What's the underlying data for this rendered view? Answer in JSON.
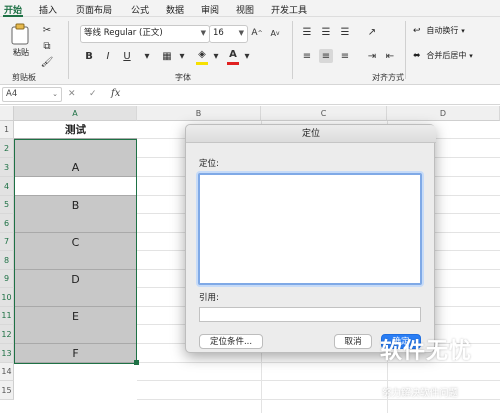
{
  "ribbon_tabs": [
    "开始",
    "插入",
    "页面布局",
    "公式",
    "数据",
    "审阅",
    "视图",
    "开发工具"
  ],
  "clipboard": {
    "paste_label": "粘贴",
    "group_label": "剪贴板"
  },
  "font": {
    "name": "等线 Regular (正文)",
    "size": "16",
    "group_label": "字体",
    "bold": "B",
    "italic": "I",
    "underline": "U",
    "grow": "A",
    "shrink": "A",
    "color_letter": "A",
    "fill_color": "#f6e000",
    "font_color": "#e02020"
  },
  "alignment": {
    "wrap_label": "自动换行",
    "merge_label": "合并后居中",
    "group_label": "对齐方式"
  },
  "formula_bar": {
    "name_box": "A4",
    "fx": "fx",
    "cancel": "✕",
    "enter": "✓",
    "formula": ""
  },
  "columns": [
    "A",
    "B",
    "C",
    "D"
  ],
  "rows": [
    "1",
    "2",
    "3",
    "4",
    "5",
    "6",
    "7",
    "8",
    "9",
    "10",
    "11",
    "12",
    "13",
    "14",
    "15"
  ],
  "cells_a": {
    "r1": "测试",
    "r3": "A",
    "r5": "B",
    "r7": "C",
    "r9": "D",
    "r11": "E",
    "r13": "F"
  },
  "dialog": {
    "title": "定位",
    "goto_label": "定位:",
    "reference_label": "引用:",
    "reference_value": "",
    "special_button": "定位条件...",
    "cancel_button": "取消",
    "ok_button": "确定"
  },
  "watermark": {
    "title": "软件无忧",
    "subtitle": "努力解决软件问题"
  },
  "colors": {
    "accent": "#1e7145",
    "selection": "#c8c8c8",
    "dialog_primary": "#2a7ef5",
    "focus_ring": "#7fa9e6"
  }
}
